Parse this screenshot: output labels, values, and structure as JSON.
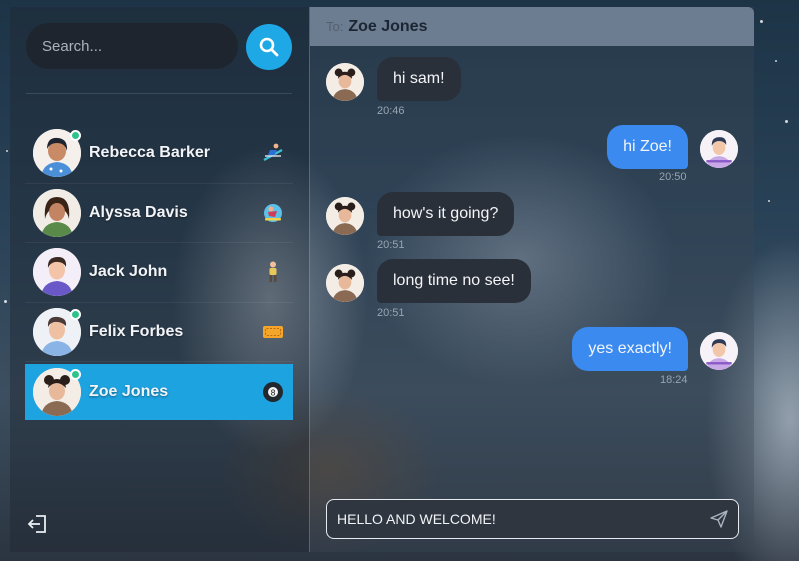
{
  "sidebar": {
    "search": {
      "placeholder": "Search..."
    },
    "contacts": [
      {
        "name": "Rebecca Barker",
        "online": true,
        "emoji": "skier-icon",
        "active": false
      },
      {
        "name": "Alyssa Davis",
        "online": false,
        "emoji": "snowboarder-icon",
        "active": false
      },
      {
        "name": "Jack John",
        "online": false,
        "emoji": "person-walking-icon",
        "active": false
      },
      {
        "name": "Felix Forbes",
        "online": true,
        "emoji": "ticket-icon",
        "active": false
      },
      {
        "name": "Zoe Jones",
        "online": true,
        "emoji": "8-ball-icon",
        "active": true
      }
    ]
  },
  "chat": {
    "to_label": "To:",
    "recipient": "Zoe Jones",
    "messages": [
      {
        "direction": "in",
        "text": "hi sam!",
        "time": "20:46"
      },
      {
        "direction": "out",
        "text": "hi Zoe!",
        "time": "20:50"
      },
      {
        "direction": "in",
        "text": "how's it going?",
        "time": "20:51"
      },
      {
        "direction": "in",
        "text": "long time no see!",
        "time": "20:51"
      },
      {
        "direction": "out",
        "text": "yes exactly!",
        "time": "18:24"
      }
    ],
    "composer": {
      "value": "HELLO AND WELCOME!"
    }
  },
  "colors": {
    "accent": "#1da3e0",
    "outgoing_bubble": "#3b8af0",
    "incoming_bubble": "#2a3039",
    "online": "#2fc28a"
  }
}
